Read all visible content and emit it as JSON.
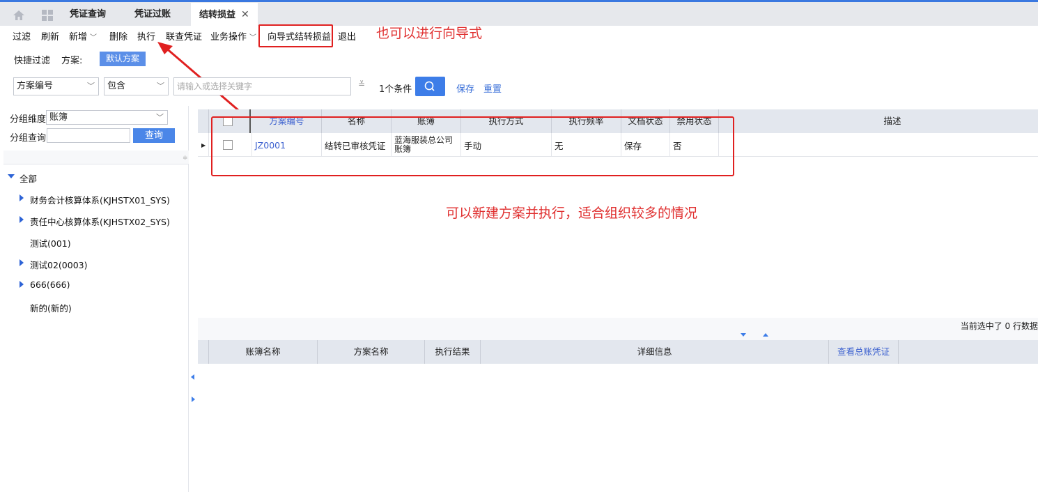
{
  "tabs": [
    {
      "label": "凭证查询"
    },
    {
      "label": "凭证过账"
    },
    {
      "label": "结转损益",
      "active": true
    }
  ],
  "toolbar": {
    "filter": "过滤",
    "refresh": "刷新",
    "add": "新增",
    "delete": "删除",
    "execute": "执行",
    "linked_voucher": "联查凭证",
    "business_ops": "业务操作",
    "wizard": "向导式结转损益",
    "exit": "退出"
  },
  "annotations": {
    "wizard_note": "也可以进行向导式",
    "plan_note": "可以新建方案并执行，适合组织较多的情况"
  },
  "quick_filter": {
    "label": "快捷过滤",
    "plan_label": "方案:",
    "default_plan": "默认方案"
  },
  "filter_row": {
    "field": "方案编号",
    "operator": "包含",
    "placeholder": "请输入或选择关键字",
    "condition_count": "1个条件",
    "save": "保存",
    "reset": "重置"
  },
  "left_panel": {
    "group_dim_label": "分组维度",
    "group_dim_value": "账簿",
    "group_query_label": "分组查询",
    "query_button": "查询",
    "tree": {
      "root": "全部",
      "items": [
        {
          "label": "财务会计核算体系(KJHSTX01_SYS)",
          "expandable": true
        },
        {
          "label": "责任中心核算体系(KJHSTX02_SYS)",
          "expandable": true
        },
        {
          "label": "测试(001)",
          "expandable": false
        },
        {
          "label": "测试02(0003)",
          "expandable": true
        },
        {
          "label": "666(666)",
          "expandable": true
        },
        {
          "label": "新的(新的)",
          "expandable": false
        }
      ]
    }
  },
  "grid": {
    "columns": [
      "方案编号",
      "名称",
      "账簿",
      "执行方式",
      "执行频率",
      "文档状态",
      "禁用状态",
      "描述"
    ],
    "rows": [
      {
        "code": "JZ0001",
        "name": "结转已审核凭证",
        "book": "蓝海服装总公司账簿",
        "exec_mode": "手动",
        "frequency": "无",
        "doc_status": "保存",
        "disabled": "否",
        "description": ""
      }
    ]
  },
  "status": {
    "selected_text": "当前选中了 0 行数据"
  },
  "result_grid": {
    "columns": [
      "账簿名称",
      "方案名称",
      "执行结果",
      "详细信息",
      "查看总账凭证"
    ]
  },
  "colors": {
    "accent": "#3d7de8",
    "annotation_red": "#e02020",
    "header_bg": "#e3e7ee"
  }
}
